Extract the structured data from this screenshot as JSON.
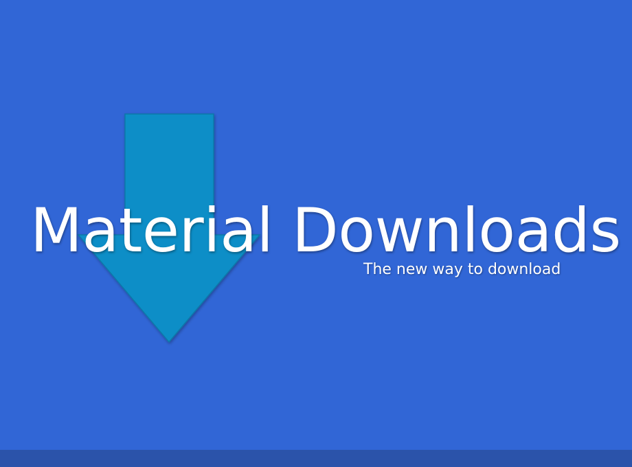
{
  "app": {
    "title": "Material Downloads",
    "tagline": "The new way to download"
  },
  "graphic": {
    "icon": "download-arrow-icon",
    "arrow_color": "#0f8ec7",
    "arrow_edge_color": "#0d78a8"
  },
  "colors": {
    "background": "#3166d6",
    "bottom_bar": "#2b53aa",
    "text": "#ffffff"
  }
}
